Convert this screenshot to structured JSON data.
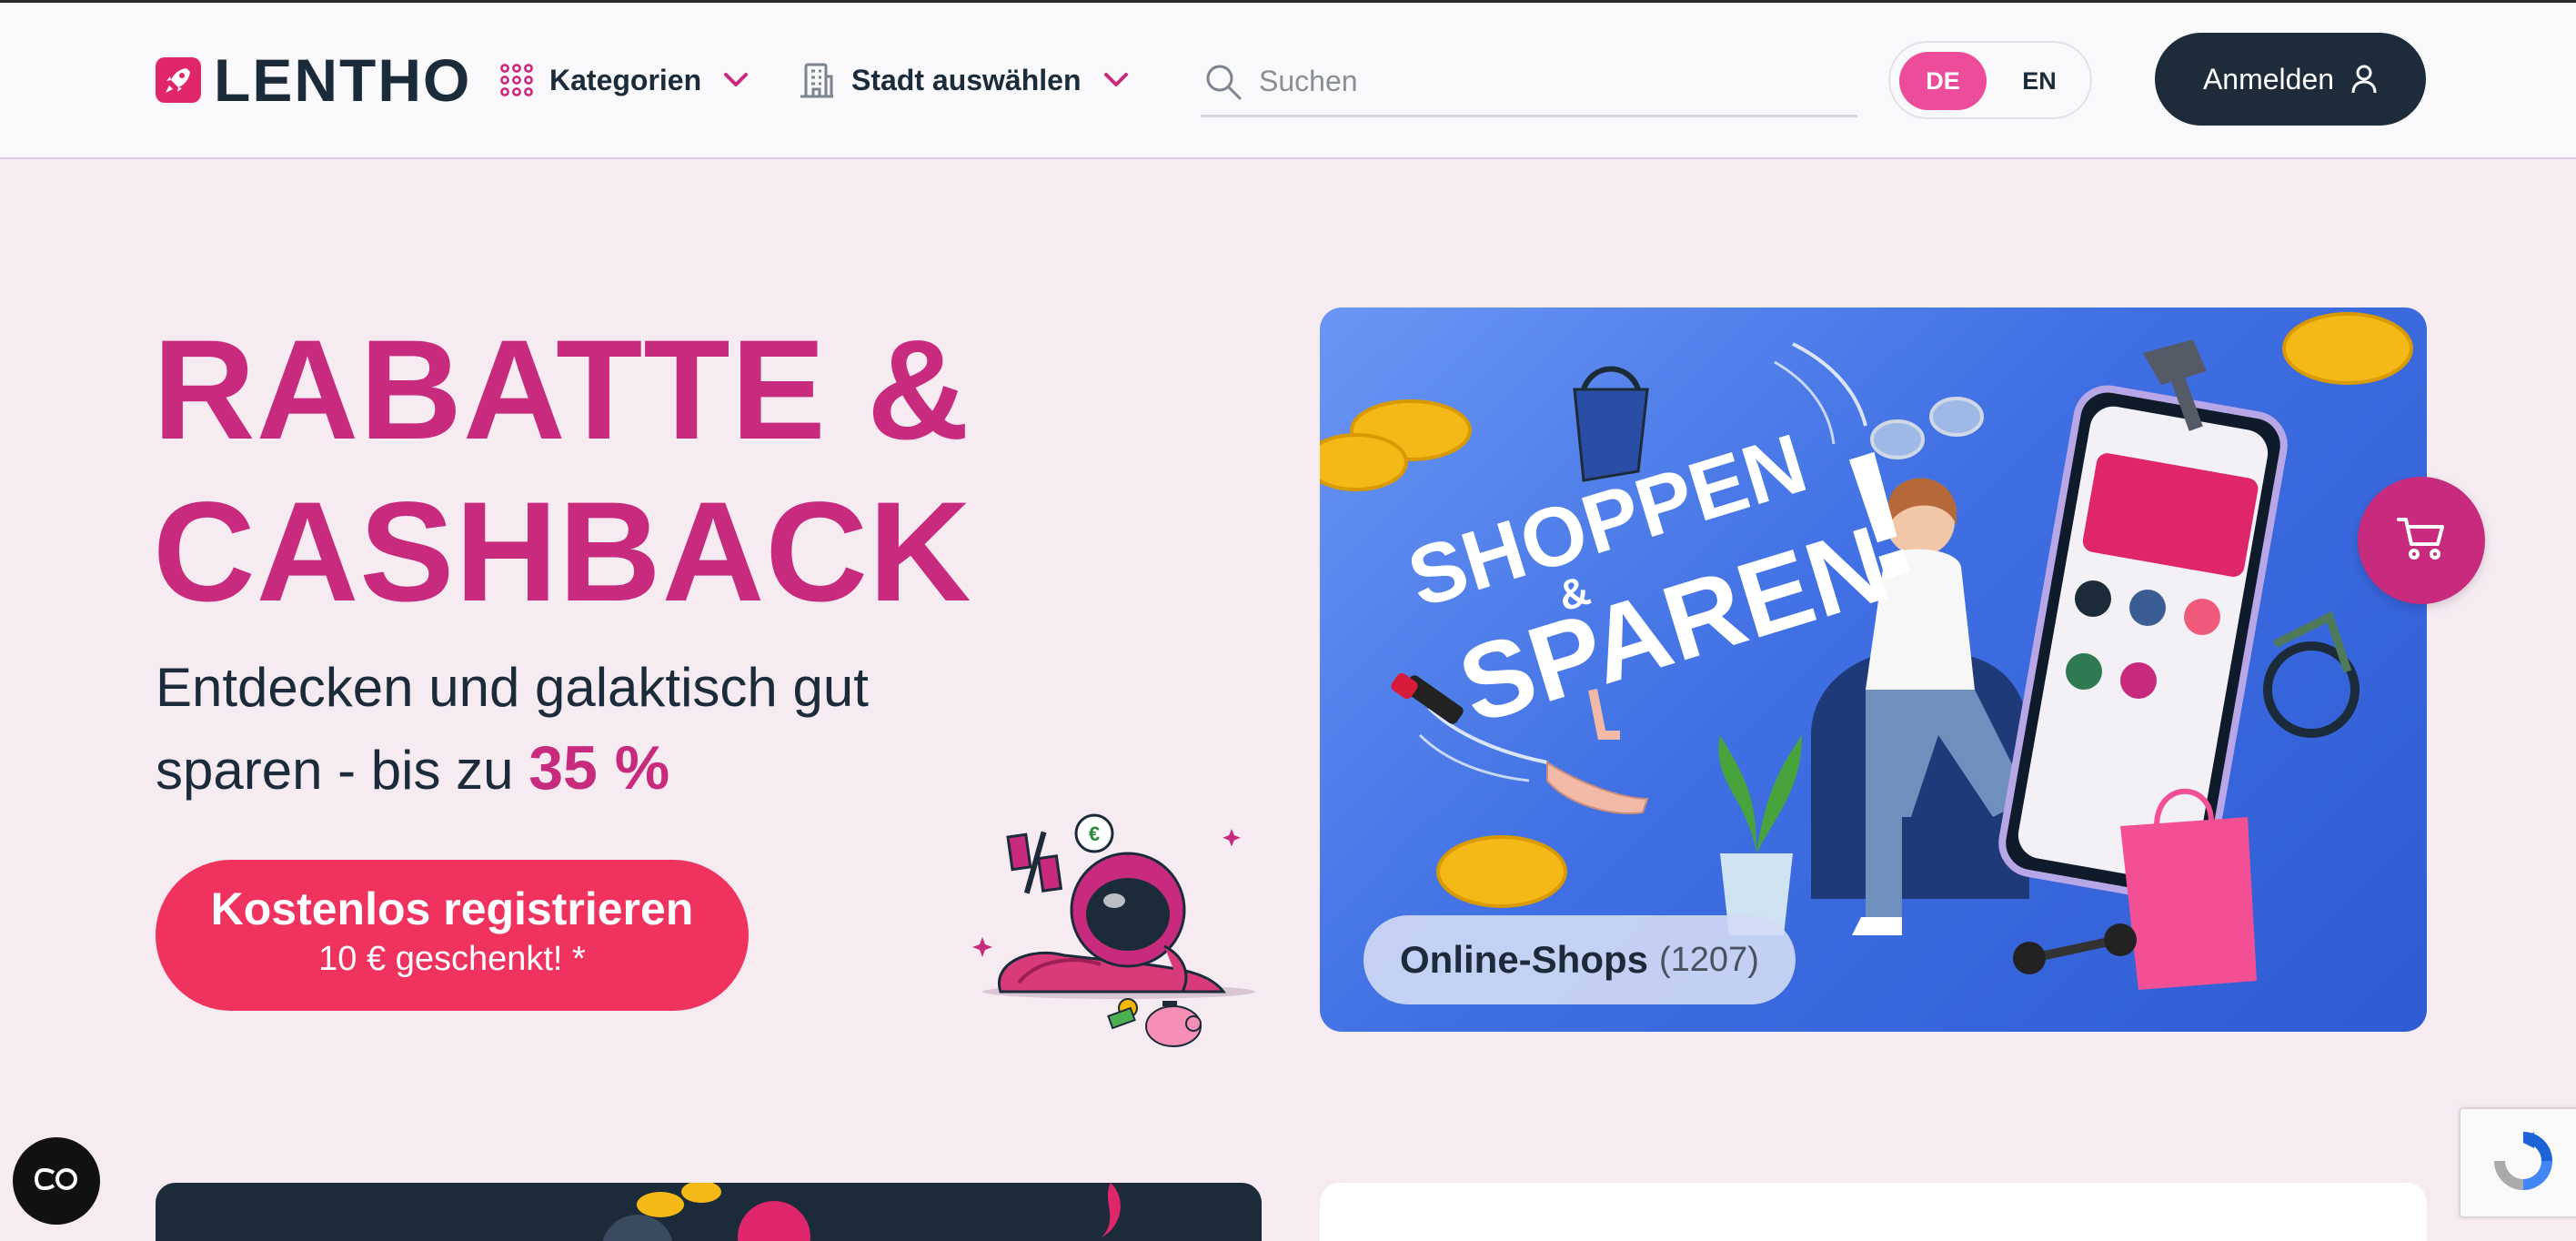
{
  "header": {
    "logo_text": "LENTHO",
    "nav": {
      "categories_label": "Kategorien",
      "city_label": "Stadt auswählen"
    },
    "search": {
      "placeholder": "Suchen",
      "value": ""
    },
    "language": {
      "options": [
        "DE",
        "EN"
      ],
      "selected": "DE"
    },
    "login_label": "Anmelden"
  },
  "hero": {
    "title_line1": "RABATTE &",
    "title_line2": "CASHBACK",
    "subtitle_part1": "Entdecken und galaktisch gut sparen - bis zu ",
    "subtitle_highlight": "35 %",
    "cta_main": "Kostenlos registrieren",
    "cta_sub": "10 € geschenkt! *"
  },
  "banner": {
    "headline": "SHOPPEN & SPAREN!",
    "badge_label": "Online-Shops",
    "badge_count": "(1207)"
  },
  "colors": {
    "brand_pink": "#c82b7e",
    "cta_red": "#f0325f",
    "lang_active": "#ec4c9a",
    "dark_navy": "#1d2b3a",
    "page_bg": "#f7ebf2"
  },
  "icons": {
    "logo": "rocket-icon",
    "categories": "grid-dots-icon",
    "city": "building-icon",
    "search": "search-icon",
    "login": "user-icon",
    "cart": "cart-icon",
    "cookie": "cookie-settings-icon",
    "recaptcha": "recaptcha-icon"
  }
}
